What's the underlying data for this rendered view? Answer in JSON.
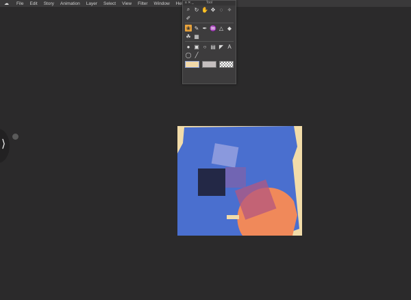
{
  "menubar": {
    "items": [
      "File",
      "Edit",
      "Story",
      "Animation",
      "Layer",
      "Select",
      "View",
      "Filter",
      "Window",
      "Help"
    ]
  },
  "palette": {
    "title": "Tool",
    "controls": "≡ ✕ _",
    "tools_row1": [
      "⌕",
      "↻",
      "✋",
      "✥",
      "◌",
      "✧",
      "✐"
    ],
    "tools_row2": [
      "❀",
      "✎",
      "✒",
      "♒",
      "△",
      "◆",
      "☘",
      "▦"
    ],
    "tools_row3": [
      "●",
      "▣",
      "○",
      "▤",
      "◤",
      "A",
      "◯",
      "╱"
    ],
    "colors": {
      "main": "#f1d9ab",
      "sub": "#c5bfbf"
    }
  },
  "sidehandle": {
    "icon": "⟩"
  },
  "colors": {
    "background": "#2b2a2b",
    "canvas_blue": "#4a6fcf",
    "orange": "#f0895a",
    "cream": "#f2dca9"
  }
}
